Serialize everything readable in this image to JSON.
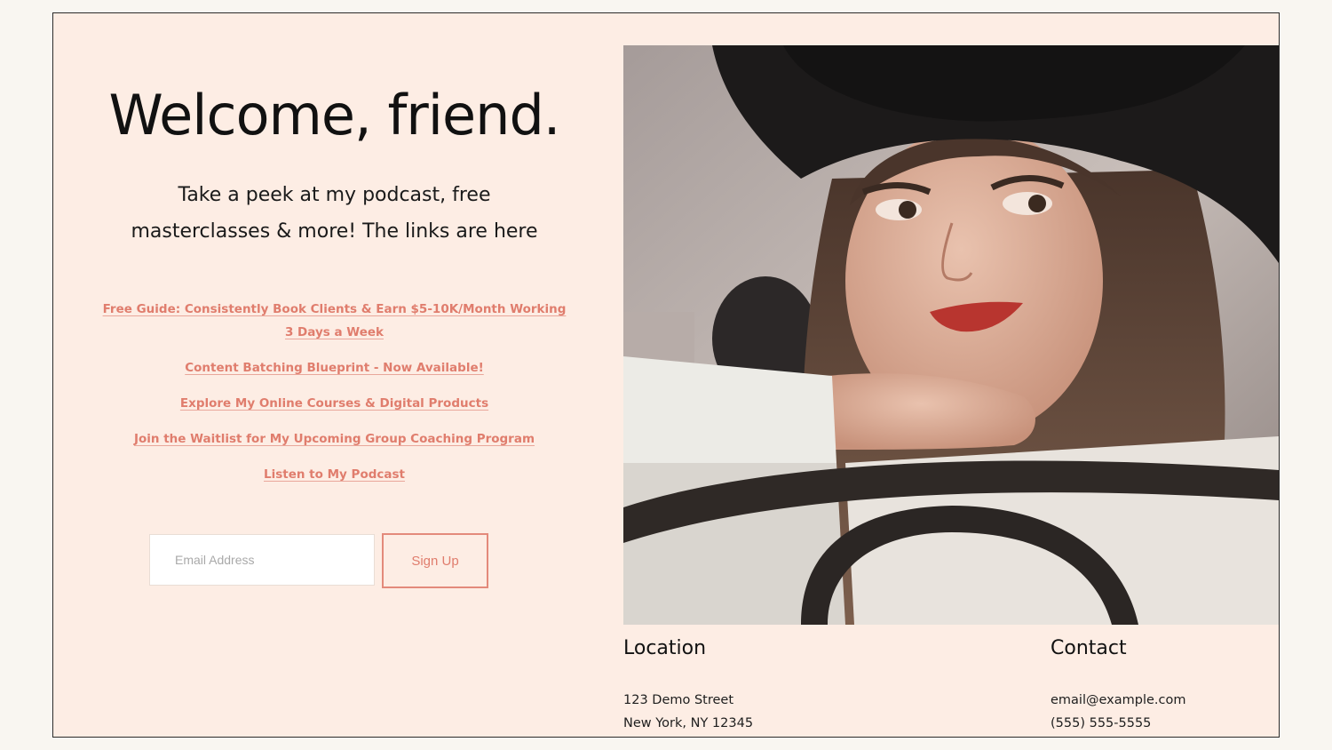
{
  "hero": {
    "title": "Welcome, friend.",
    "subtitle": "Take a peek at my podcast, free masterclasses & more! The links are here"
  },
  "links": [
    "Free Guide: Consistently Book Clients & Earn $5-10K/Month Working 3 Days a Week",
    "Content Batching Blueprint - Now Available!",
    "Explore My Online Courses & Digital Products",
    "Join the Waitlist for My Upcoming Group Coaching Program",
    "Listen to My Podcast"
  ],
  "signup": {
    "email_placeholder": "Email Address",
    "button_label": "Sign Up"
  },
  "location": {
    "title": "Location",
    "line1": "123 Demo Street",
    "line2": "New York, NY 12345"
  },
  "contact": {
    "title": "Contact",
    "email": "email@example.com",
    "phone": "(555) 555-5555"
  },
  "colors": {
    "page_background": "#fdede4",
    "accent": "#e07d6d"
  }
}
